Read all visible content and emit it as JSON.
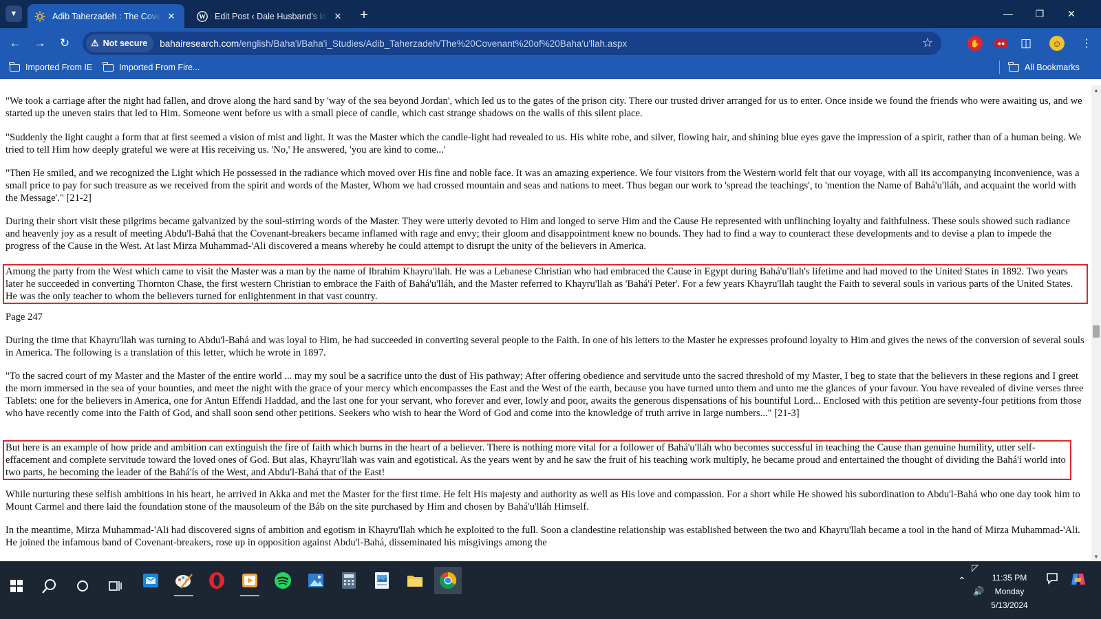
{
  "browser": {
    "tabs": [
      {
        "title": "Adib Taherzadeh : The Covenant of Bahá'u'lláh",
        "active": true
      },
      {
        "title": "Edit Post ‹ Dale Husband's Intellectual Blog",
        "active": false
      }
    ],
    "address": {
      "security_label": "Not secure",
      "host": "bahairesearch.com",
      "path": "/english/Baha'i/Baha'i_Studies/Adib_Taherzadeh/The%20Covenant%20of%20Baha'u'llah.aspx"
    },
    "bookmarks": [
      "Imported From IE",
      "Imported From Fire..."
    ],
    "all_bookmarks_label": "All Bookmarks"
  },
  "page": {
    "paragraphs": [
      {
        "text": "\"We took a carriage after the night had fallen, and drove along the hard sand by 'way of the sea beyond Jordan', which led us to the gates of the prison city. There our trusted driver arranged for us to enter. Once inside we found the friends who were awaiting us, and we started up the uneven stairs that led to Him. Someone went before us with a small piece of candle, which cast strange shadows on the walls of this silent place.",
        "highlighted": false
      },
      {
        "text": "\"Suddenly the light caught a form that at first seemed a vision of mist and light. It was the Master which the candle-light had revealed to us. His white robe, and silver, flowing hair, and shining blue eyes gave the impression of a spirit, rather than of a human being. We tried to tell Him how deeply grateful we were at His receiving us. 'No,' He answered, 'you are kind to come...'",
        "highlighted": false
      },
      {
        "text": "\"Then He smiled, and we recognized the Light which He possessed in the radiance which moved over His fine and noble face. It was an amazing experience. We four visitors from the Western world felt that our voyage, with all its accompanying inconvenience, was a small price to pay for such treasure as we received from the spirit and words of the Master, Whom we had crossed mountain and seas and nations to meet. Thus began our work to 'spread the teachings', to 'mention the Name of Bahá'u'lláh, and acquaint the world with the Message'.\" [21-2]",
        "highlighted": false
      },
      {
        "text": "During their short visit these pilgrims became galvanized by the soul-stirring words of the Master. They were utterly devoted to Him and longed to serve Him and the Cause He represented with unflinching loyalty and faithfulness. These souls showed such radiance and heavenly joy as a result of meeting Abdu'l-Bahá that the Covenant-breakers became inflamed with rage and envy; their gloom and disappointment knew no bounds. They had to find a way to counteract these developments and to devise a plan to impede the progress of the Cause in the West. At last Mirza Muhammad-'Ali discovered a means whereby he could attempt to disrupt the unity of the believers in America.",
        "highlighted": false
      },
      {
        "text": "Among the party from the West which came to visit the Master was a man by the name of Ibrahim Khayru'llah. He was a Lebanese Christian who had embraced the Cause in Egypt during Bahá'u'llah's lifetime and had moved to the United States in 1892. Two years later he succeeded in converting Thornton Chase, the first western Christian to embrace the Faith of Bahá'u'lláh, and the Master referred to Khayru'llah as 'Bahá'í Peter'. For a few years Khayru'llah taught the Faith to several souls in various parts of the United States. He was the only teacher to whom the believers turned for enlightenment in that vast country.",
        "highlighted": true
      },
      {
        "text": "Page 247",
        "highlighted": false
      },
      {
        "text": "During the time that Khayru'llah was turning to Abdu'l-Bahá and was loyal to Him, he had succeeded in converting several people to the Faith. In one of his letters to the Master he expresses profound loyalty to Him and gives the news of the conversion of several souls in America. The following is a translation of this letter, which he wrote in 1897.",
        "highlighted": false
      },
      {
        "text": "\"To the sacred court of my Master and the Master of the entire world ... may my soul be a sacrifice unto the dust of His pathway; After offering obedience and servitude unto the sacred threshold of my Master, I beg to state that the believers in these regions and I greet the morn immersed in the sea of your bounties, and meet the night with the grace of your mercy which encompasses the East and the West of the earth, because you have turned unto them and unto me the glances of your favour. You have revealed of divine verses three Tablets: one for the believers in America, one for Antun Effendi Haddad, and the last one for your servant, who forever and ever, lowly and poor, awaits the generous dispensations of his bountiful Lord... Enclosed with this petition are seventy-four petitions from those who have recently come into the Faith of God, and shall soon send other petitions. Seekers who wish to hear the Word of God and come into the knowledge of truth arrive in large numbers...\" [21-3]",
        "highlighted": false
      },
      {
        "text": "But here is an example of how pride and ambition can extinguish the fire of faith which burns in the heart of a believer. There is nothing more vital for a follower of Bahá'u'lláh who becomes successful in teaching the Cause than genuine humility, utter self-effacement and complete servitude toward the loved ones of God. But alas, Khayru'llah was vain and egotistical. As the years went by and he saw the fruit of his teaching work multiply, he became proud and entertained the thought of dividing the Bahá'í world into two parts, he becoming the leader of the Bahá'ís of the West, and Abdu'l-Bahá that of the East!",
        "highlighted": true
      },
      {
        "text": "While nurturing these selfish ambitions in his heart, he arrived in Akka and met the Master for the first time. He felt His majesty and authority as well as His love and compassion. For a short while He showed his subordination to Abdu'l-Bahá who one day took him to Mount Carmel and there laid the foundation stone of the mausoleum of the Báb on the site purchased by Him and chosen by Bahá'u'lláh Himself.",
        "highlighted": false
      },
      {
        "text": "In the meantime, Mirza Muhammad-'Ali had discovered signs of ambition and egotism in Khayru'llah which he exploited to the full. Soon a clandestine relationship was established between the two and Khayru'llah became a tool in the hand of Mirza Muhammad-'Ali. He joined the infamous band of Covenant-breakers, rose up in opposition against Abdu'l-Bahá, disseminated his misgivings among the",
        "highlighted": false
      }
    ],
    "highlight_color": "#e0252c"
  },
  "taskbar": {
    "apps": [
      "outlook-icon",
      "paint-icon",
      "opera-icon",
      "media-player-icon",
      "spotify-icon",
      "photos-icon",
      "calculator-icon",
      "image-viewer-icon",
      "file-explorer-icon",
      "chrome-icon"
    ],
    "clock": {
      "time": "11:35 PM",
      "day": "Monday",
      "date": "5/13/2024"
    }
  },
  "colors": {
    "tab_strip": "#0f2a55",
    "toolbar": "#1f5bb5",
    "taskbar": "#1c2633"
  }
}
